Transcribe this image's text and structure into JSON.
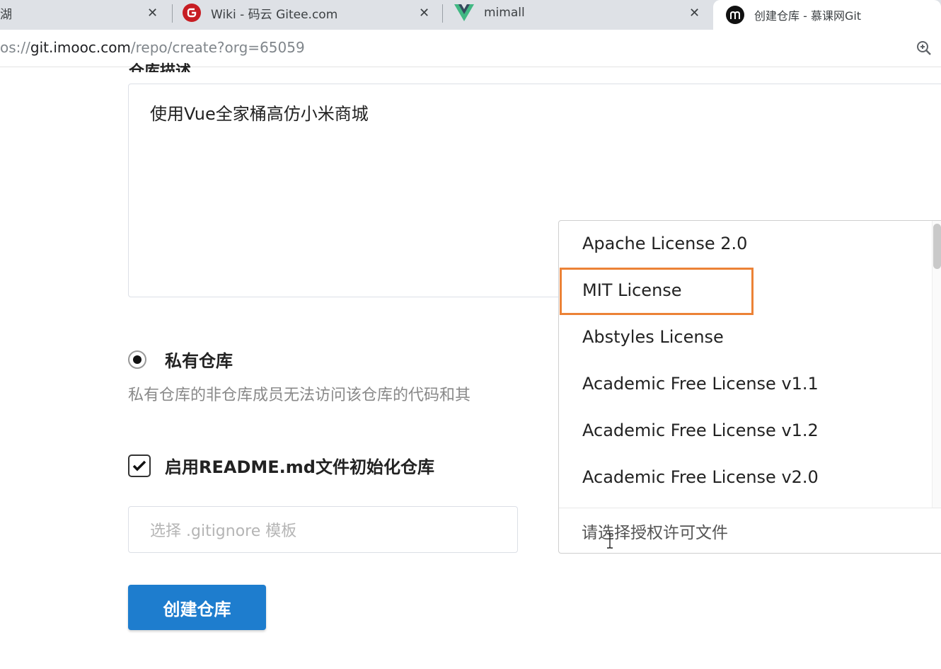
{
  "browser": {
    "tabs": [
      {
        "title": "湖",
        "favicon": "partial-tab"
      },
      {
        "title": "Wiki - 码云 Gitee.com",
        "favicon": "gitee-icon"
      },
      {
        "title": "mimall",
        "favicon": "vue-icon"
      },
      {
        "title": "创建仓库 - 慕课网Git",
        "favicon": "imooc-icon",
        "active": true
      }
    ],
    "close_glyph": "✕",
    "url_prefix": "os://",
    "url_host": "git.imooc.com",
    "url_path": "/repo/create?org=65059"
  },
  "form": {
    "description_label": "仓库描述",
    "description_value": "使用Vue全家桶高仿小米商城",
    "private_label": "私有仓库",
    "private_desc": "私有仓库的非仓库成员无法访问该仓库的代码和其",
    "readme_label": "启用README.md文件初始化仓库",
    "gitignore_placeholder": "选择 .gitignore 模板",
    "submit_label": "创建仓库"
  },
  "license_dropdown": {
    "options": [
      "Apache License 2.0",
      "MIT License",
      "Abstyles License",
      "Academic Free License v1.1",
      "Academic Free License v1.2",
      "Academic Free License v2.0"
    ],
    "highlighted": "MIT License",
    "placeholder": "请选择授权许可文件"
  },
  "colors": {
    "highlight_border": "#ec8236",
    "primary_button": "#1e7dce",
    "gitee_red": "#c71d23",
    "vue_green": "#41b883"
  }
}
